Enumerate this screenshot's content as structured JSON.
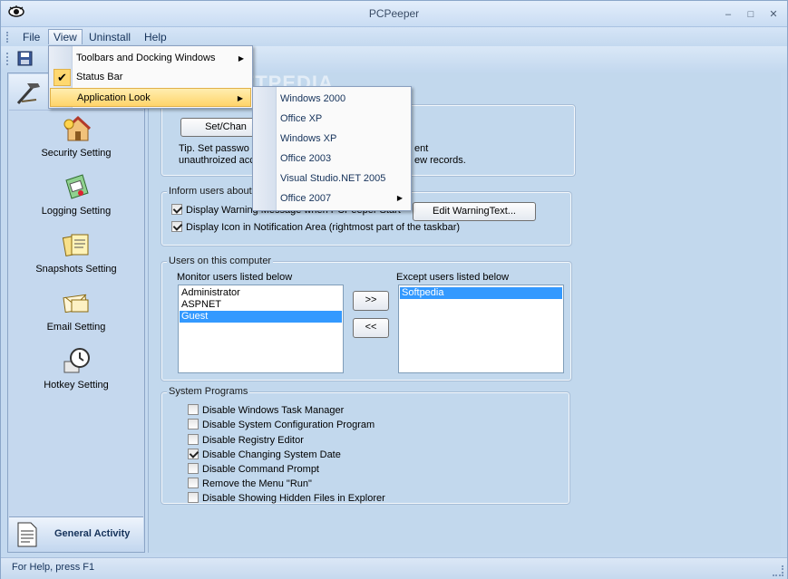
{
  "window": {
    "title": "PCPeeper",
    "minimize": "–",
    "maximize": "□",
    "close": "✕"
  },
  "menubar": {
    "file": "File",
    "view": "View",
    "uninstall": "Uninstall",
    "help": "Help"
  },
  "view_menu": {
    "items": [
      {
        "label": "Toolbars and Docking Windows",
        "submenu": true
      },
      {
        "label": "Status Bar",
        "checked": true
      },
      {
        "label": "Application Look",
        "submenu": true
      }
    ],
    "check_glyph": "✔",
    "arrow_glyph": "▶"
  },
  "look_submenu": {
    "items": [
      {
        "label": "Windows 2000"
      },
      {
        "label": "Office XP"
      },
      {
        "label": "Windows XP"
      },
      {
        "label": "Office 2003"
      },
      {
        "label": "Visual Studio.NET 2005"
      },
      {
        "label": "Office 2007",
        "submenu": true
      }
    ]
  },
  "sidebar": {
    "items": [
      {
        "label": "Security Setting",
        "icon": "security-house-icon"
      },
      {
        "label": "Logging Setting",
        "icon": "logging-icon"
      },
      {
        "label": "Snapshots Setting",
        "icon": "snapshots-icon"
      },
      {
        "label": "Email Setting",
        "icon": "email-icon"
      },
      {
        "label": "Hotkey Setting",
        "icon": "hotkey-clock-icon"
      }
    ],
    "bottom_label": "General Activity"
  },
  "password_group": {
    "button": "Set/Chan",
    "tip_line1": "Tip. Set passwo",
    "tip_line1_tail": "ent",
    "tip_line2": "unauthroized acc",
    "tip_line2_tail": "ew records."
  },
  "inform_group": {
    "legend": "Inform users about",
    "warning_label": "Display Warning Message when PCPeeper Start",
    "warning_checked": true,
    "icon_label": "Display Icon in Notification Area (rightmost part of the taskbar)",
    "icon_checked": true,
    "edit_button": "Edit WarningText..."
  },
  "users_group": {
    "legend": "Users on this computer",
    "monitor_label": "Monitor users listed below",
    "except_label": "Except users listed below",
    "monitor_users": [
      "Administrator",
      "ASPNET",
      "Guest"
    ],
    "monitor_selected": "Guest",
    "except_users": [
      "Softpedia"
    ],
    "except_selected": "Softpedia",
    "move_right": ">>",
    "move_left": "<<"
  },
  "system_group": {
    "legend": "System Programs",
    "items": [
      {
        "label": "Disable Windows Task Manager",
        "checked": false
      },
      {
        "label": "Disable System Configuration Program",
        "checked": false
      },
      {
        "label": "Disable Registry Editor",
        "checked": false
      },
      {
        "label": "Disable Changing System Date",
        "checked": true
      },
      {
        "label": "Disable Command Prompt",
        "checked": false
      },
      {
        "label": "Remove the Menu \"Run\"",
        "checked": false
      },
      {
        "label": "Disable Showing Hidden Files in Explorer",
        "checked": false
      }
    ]
  },
  "watermark": "SOFTPEDIA",
  "statusbar": {
    "text": "For Help, press F1"
  }
}
